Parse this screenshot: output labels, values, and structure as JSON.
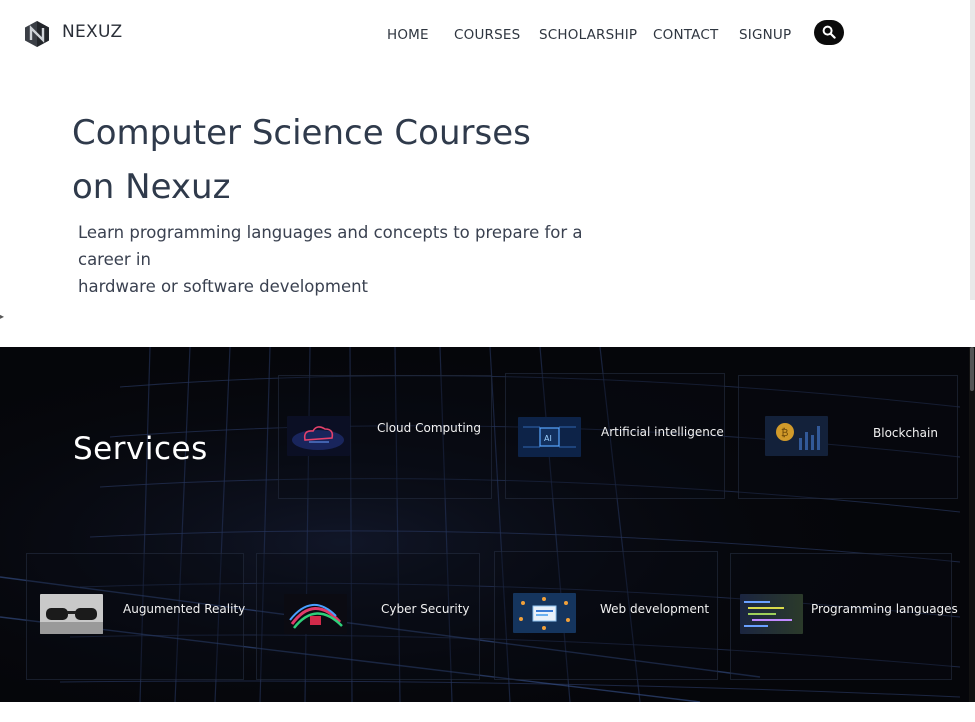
{
  "brand": {
    "name": "NEXUZ",
    "logo_icon": "nexuz-logo-icon"
  },
  "nav": {
    "items": [
      {
        "label": "HOME"
      },
      {
        "label": "COURSES"
      },
      {
        "label": "SCHOLARSHIP"
      },
      {
        "label": "CONTACT"
      },
      {
        "label": "SIGNUP"
      }
    ],
    "search_icon": "search-icon"
  },
  "hero": {
    "title_line1": "Computer Science Courses",
    "title_line2": "on Nexuz",
    "subtitle_line1": "Learn programming languages and concepts to prepare for a career in",
    "subtitle_line2": "hardware or software development"
  },
  "services": {
    "title": "Services",
    "items": [
      {
        "label": "Cloud Computing",
        "thumb": "cloud-image"
      },
      {
        "label": "Artificial intelligence",
        "thumb": "ai-chip-image"
      },
      {
        "label": "Blockchain",
        "thumb": "bitcoin-image"
      },
      {
        "label": "Augumented Reality",
        "thumb": "ar-glasses-image"
      },
      {
        "label": "Cyber Security",
        "thumb": "cyber-lock-image"
      },
      {
        "label": "Web development",
        "thumb": "web-dev-image"
      },
      {
        "label": "Programming languages",
        "thumb": "code-screen-image"
      }
    ]
  },
  "colors": {
    "dark_bg": "#05060a",
    "text_dark": "#2f3a4b",
    "accent_blue": "#2a6bd6"
  }
}
